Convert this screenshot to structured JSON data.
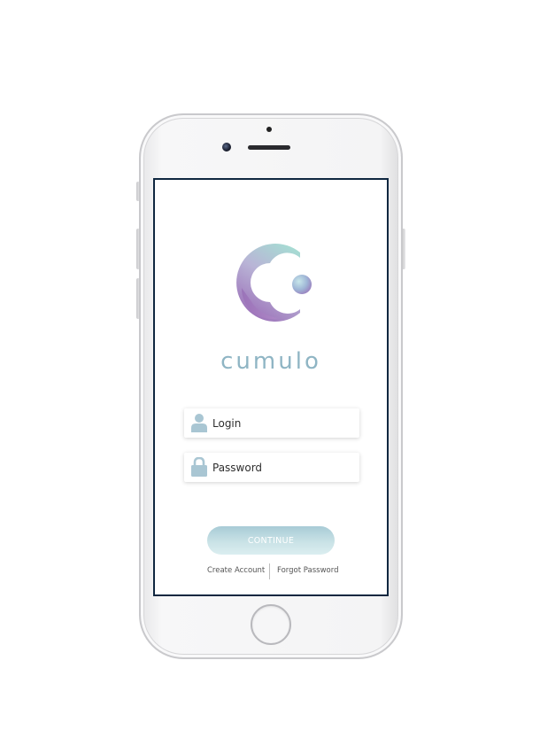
{
  "app": {
    "brand_name": "cumulo"
  },
  "login_form": {
    "login_placeholder": "Login",
    "password_placeholder": "Password",
    "continue_label": "CONTINUE"
  },
  "footer_links": {
    "create_account": "Create Account",
    "forgot_password": "Forgot Password"
  },
  "colors": {
    "brand_text": "#8fb5c4",
    "logo_gradient_start": "#a6dcd3",
    "logo_gradient_end": "#9b6fb8",
    "button_gradient_top": "#a8cbd6",
    "button_gradient_bottom": "#dbeef0",
    "icon_color": "#a9c6d3"
  },
  "icons": {
    "login": "user-icon",
    "password": "lock-icon",
    "logo": "cumulo-logo"
  }
}
